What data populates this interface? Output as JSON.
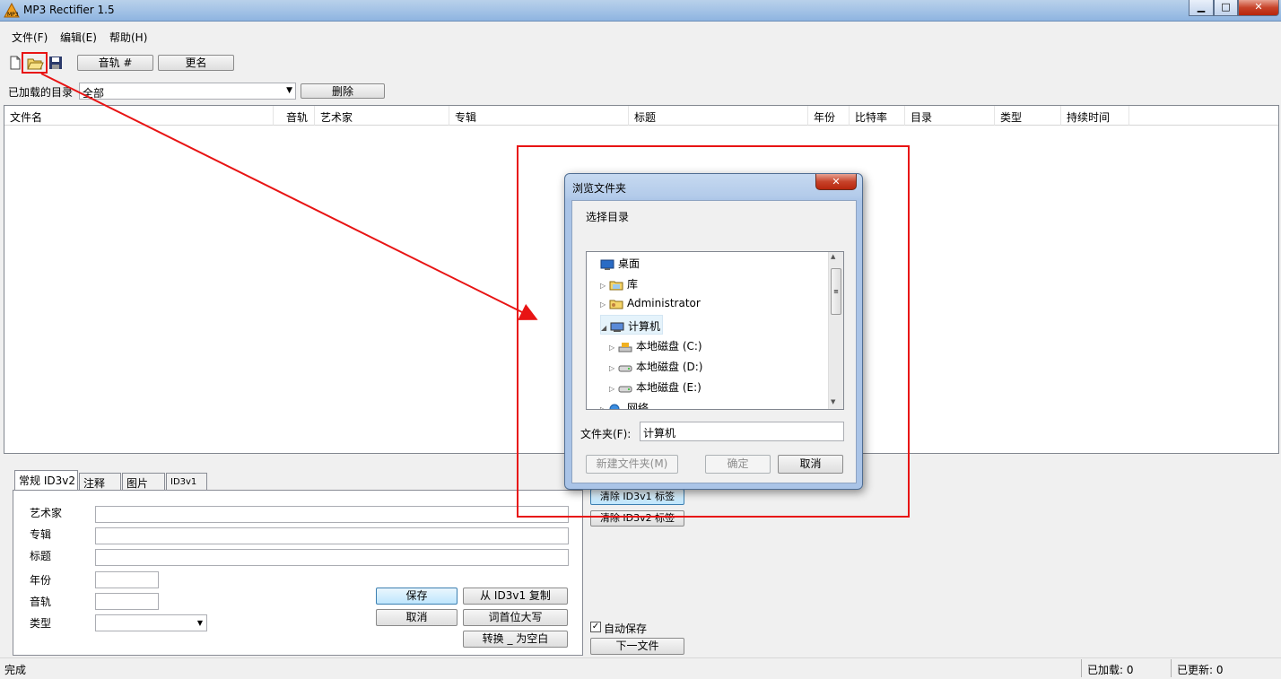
{
  "window": {
    "title": "MP3 Rectifier 1.5",
    "minimize": "▁",
    "maximize": "□",
    "close": "✕",
    "app_icon": "mp3-app-icon"
  },
  "menu": [
    "文件(F)",
    "编辑(E)",
    "帮助(H)"
  ],
  "toolbar": {
    "new_icon": "new-file-icon",
    "open_icon": "open-folder-icon",
    "save_icon": "save-icon",
    "track_button": "音轨 #",
    "rename_button": "更名"
  },
  "dirbar": {
    "label": "已加载的目录",
    "selected": "全部",
    "delete_button": "删除"
  },
  "columns": [
    "文件名",
    "音轨",
    "艺术家",
    "专辑",
    "标题",
    "年份",
    "比特率",
    "目录",
    "类型",
    "持续时间"
  ],
  "tabs": [
    "常规 ID3v2",
    "注释",
    "图片",
    "ID3v1"
  ],
  "fields": {
    "artist": "艺术家",
    "album": "专辑",
    "title": "标题",
    "year": "年份",
    "track": "音轨",
    "genre": "类型"
  },
  "buttons": {
    "save": "保存",
    "cancel": "取消",
    "copy_from_id3v1": "从 ID3v1 复制",
    "capitalize": "词首位大写",
    "convert_underscore": "转换 _ 为空白",
    "clear_id3v1": "清除 ID3v1 标签",
    "clear_id3v2": "清除 ID3v2 标签",
    "auto_save": "自动保存",
    "next_file": "下一文件"
  },
  "status": {
    "text": "完成",
    "loaded": "已加载: 0",
    "updated": "已更新: 0"
  },
  "dialog": {
    "title": "浏览文件夹",
    "prompt": "选择目录",
    "tree": [
      {
        "label": "桌面",
        "icon": "desktop-icon",
        "indent": 0,
        "arrow": ""
      },
      {
        "label": "库",
        "icon": "library-icon",
        "indent": 1,
        "arrow": "▷"
      },
      {
        "label": "Administrator",
        "icon": "user-folder-icon",
        "indent": 1,
        "arrow": "▷"
      },
      {
        "label": "计算机",
        "icon": "computer-icon",
        "indent": 1,
        "arrow": "◢"
      },
      {
        "label": "本地磁盘 (C:)",
        "icon": "system-drive-icon",
        "indent": 2,
        "arrow": "▷"
      },
      {
        "label": "本地磁盘 (D:)",
        "icon": "drive-icon",
        "indent": 2,
        "arrow": "▷"
      },
      {
        "label": "本地磁盘 (E:)",
        "icon": "drive-icon",
        "indent": 2,
        "arrow": "▷"
      },
      {
        "label": "网络",
        "icon": "network-icon",
        "indent": 1,
        "arrow": "▷"
      }
    ],
    "folder_label": "文件夹(F):",
    "folder_value": "计算机",
    "new_folder_button": "新建文件夹(M)",
    "ok_button": "确定",
    "cancel_button": "取消"
  },
  "colors": {
    "annotation": "#e81414",
    "titlebar": "#a4c3e6"
  }
}
